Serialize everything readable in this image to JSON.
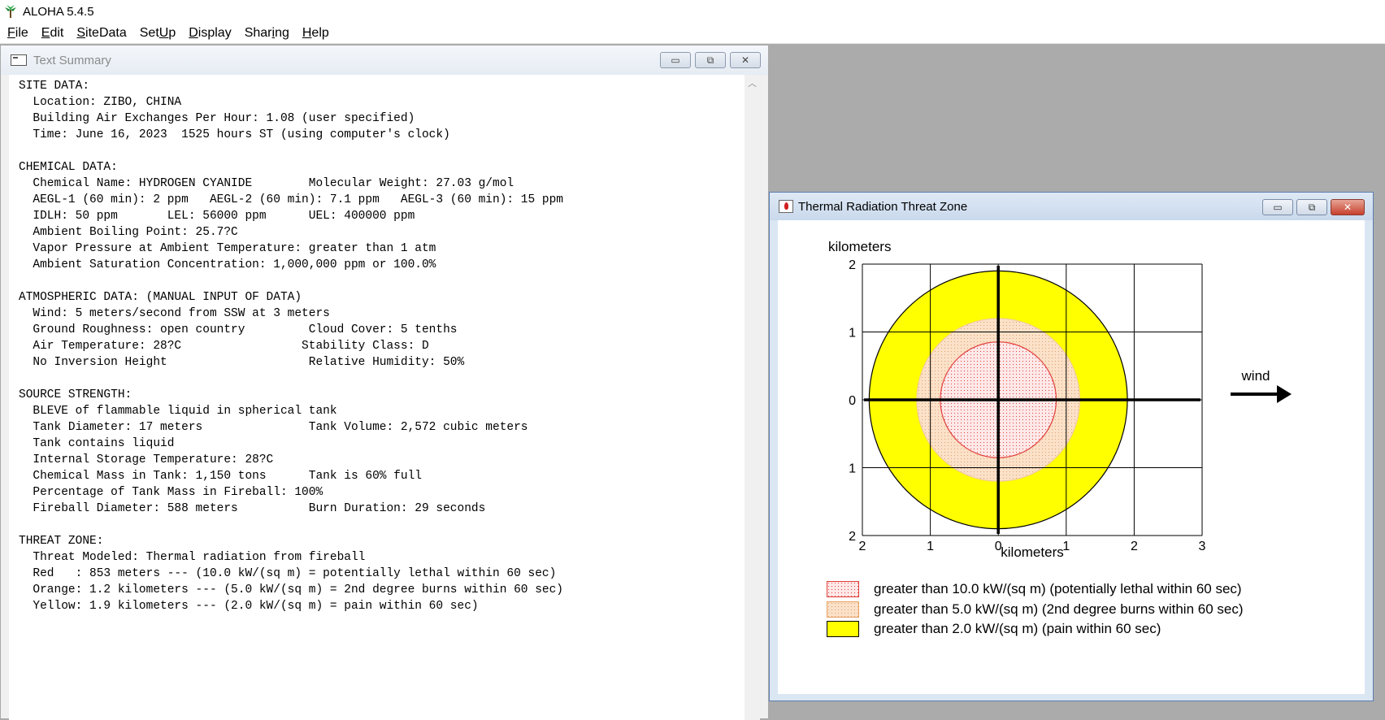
{
  "app": {
    "title": "ALOHA 5.4.5"
  },
  "menu": [
    {
      "label": "File",
      "u": "F",
      "rest": "ile"
    },
    {
      "label": "Edit",
      "u": "E",
      "rest": "dit"
    },
    {
      "label": "SiteData",
      "u": "S",
      "rest": "iteData"
    },
    {
      "label": "SetUp",
      "pre": "Set",
      "u": "U",
      "rest": "p"
    },
    {
      "label": "Display",
      "u": "D",
      "rest": "isplay"
    },
    {
      "label": "Sharing",
      "pre": "Shar",
      "u": "i",
      "rest": "ng"
    },
    {
      "label": "Help",
      "u": "H",
      "rest": "elp"
    }
  ],
  "text_summary": {
    "title": "Text Summary",
    "lines": [
      "SITE DATA:",
      "  Location: ZIBO, CHINA",
      "  Building Air Exchanges Per Hour: 1.08 (user specified)",
      "  Time: June 16, 2023  1525 hours ST (using computer's clock)",
      "",
      "CHEMICAL DATA:",
      "  Chemical Name: HYDROGEN CYANIDE        Molecular Weight: 27.03 g/mol",
      "  AEGL-1 (60 min): 2 ppm   AEGL-2 (60 min): 7.1 ppm   AEGL-3 (60 min): 15 ppm",
      "  IDLH: 50 ppm       LEL: 56000 ppm      UEL: 400000 ppm",
      "  Ambient Boiling Point: 25.7?C",
      "  Vapor Pressure at Ambient Temperature: greater than 1 atm",
      "  Ambient Saturation Concentration: 1,000,000 ppm or 100.0%",
      "",
      "ATMOSPHERIC DATA: (MANUAL INPUT OF DATA)",
      "  Wind: 5 meters/second from SSW at 3 meters",
      "  Ground Roughness: open country         Cloud Cover: 5 tenths",
      "  Air Temperature: 28?C                 Stability Class: D",
      "  No Inversion Height                    Relative Humidity: 50%",
      "",
      "SOURCE STRENGTH:",
      "  BLEVE of flammable liquid in spherical tank",
      "  Tank Diameter: 17 meters               Tank Volume: 2,572 cubic meters",
      "  Tank contains liquid",
      "  Internal Storage Temperature: 28?C",
      "  Chemical Mass in Tank: 1,150 tons      Tank is 60% full",
      "  Percentage of Tank Mass in Fireball: 100%",
      "  Fireball Diameter: 588 meters          Burn Duration: 29 seconds",
      "",
      "THREAT ZONE:",
      "  Threat Modeled: Thermal radiation from fireball",
      "  Red   : 853 meters --- (10.0 kW/(sq m) = potentially lethal within 60 sec)",
      "  Orange: 1.2 kilometers --- (5.0 kW/(sq m) = 2nd degree burns within 60 sec)",
      "  Yellow: 1.9 kilometers --- (2.0 kW/(sq m) = pain within 60 sec)"
    ]
  },
  "threat_window": {
    "title": "Thermal Radiation Threat Zone",
    "wind_label": "wind",
    "legend": [
      {
        "text": "greater than 10.0 kW/(sq m) (potentially lethal within 60 sec)",
        "fill": "#fde8e8",
        "stroke": "#e0403c",
        "dots": "#e0403c"
      },
      {
        "text": "greater than 5.0 kW/(sq m) (2nd degree burns within 60 sec)",
        "fill": "#fbe1c8",
        "stroke": "#e8a060",
        "dots": "#e0a070"
      },
      {
        "text": "greater than 2.0 kW/(sq m) (pain within 60 sec)",
        "fill": "#ffff00",
        "stroke": "#000000",
        "dots": ""
      }
    ]
  },
  "chart_data": {
    "type": "scatter",
    "xlabel": "kilometers",
    "ylabel": "kilometers",
    "xlim": [
      -2,
      3
    ],
    "ylim": [
      -2,
      2
    ],
    "x_ticks": [
      "2",
      "1",
      "0",
      "1",
      "2",
      "3"
    ],
    "y_ticks": [
      "2",
      "1",
      "0",
      "1",
      "2"
    ],
    "grid": true,
    "zones": [
      {
        "name": "Yellow",
        "radius_km": 1.9,
        "color": "#ffff00"
      },
      {
        "name": "Orange",
        "radius_km": 1.2,
        "color": "#fbe1c8"
      },
      {
        "name": "Red",
        "radius_km": 0.853,
        "color": "#fde8e8"
      }
    ]
  }
}
